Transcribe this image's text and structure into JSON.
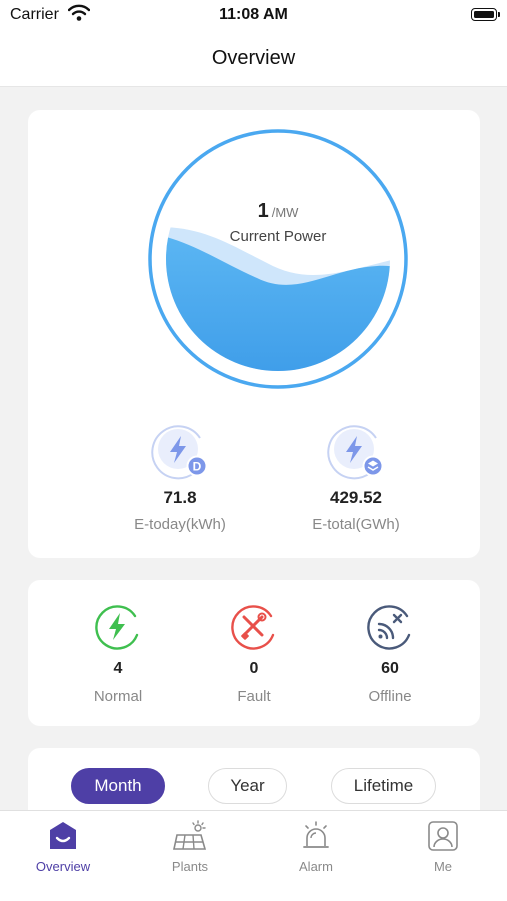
{
  "status_bar": {
    "carrier": "Carrier",
    "time": "11:08 AM"
  },
  "nav": {
    "title": "Overview"
  },
  "power": {
    "value": "1",
    "unit": "/MW",
    "label": "Current Power"
  },
  "energy": [
    {
      "value": "71.8",
      "label": "E-today(kWh)",
      "badge": "D",
      "icon": "lightning-day-icon"
    },
    {
      "value": "429.52",
      "label": "E-total(GWh)",
      "icon": "lightning-total-icon"
    }
  ],
  "statuses": [
    {
      "value": "4",
      "label": "Normal",
      "color": "#3fbf4f",
      "icon": "lightning-normal-icon"
    },
    {
      "value": "0",
      "label": "Fault",
      "color": "#e8504a",
      "icon": "tools-fault-icon"
    },
    {
      "value": "60",
      "label": "Offline",
      "color": "#4a5a7a",
      "icon": "signal-offline-icon"
    }
  ],
  "periods": {
    "month": "Month",
    "year": "Year",
    "lifetime": "Lifetime",
    "selected": "Month"
  },
  "tabs": [
    {
      "label": "Overview",
      "icon": "home-icon",
      "active": true
    },
    {
      "label": "Plants",
      "icon": "solar-panel-icon"
    },
    {
      "label": "Alarm",
      "icon": "alarm-icon"
    },
    {
      "label": "Me",
      "icon": "profile-icon"
    }
  ],
  "colors": {
    "accent": "#4e3fa6",
    "wave": "#4aa8f0",
    "ring": "#4aa8f0"
  }
}
